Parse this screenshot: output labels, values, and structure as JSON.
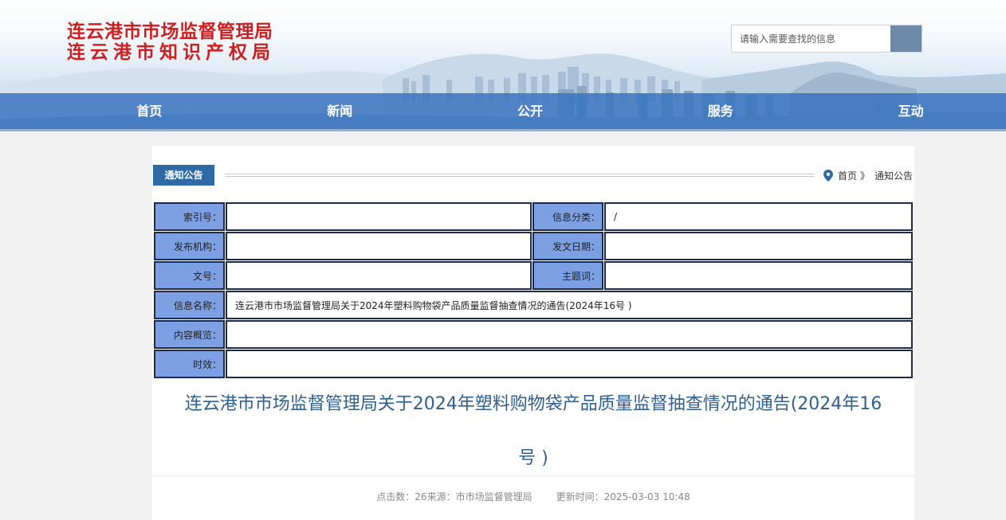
{
  "header": {
    "title_line1": "连云港市市场监督管理局",
    "title_line2": "连云港市知识产权局",
    "search_placeholder": "请输入需要查找的信息"
  },
  "nav": {
    "items": [
      "首页",
      "新闻",
      "公开",
      "服务",
      "互动"
    ]
  },
  "section": {
    "tag": "通知公告",
    "breadcrumb_home": "首页",
    "breadcrumb_sep": "》",
    "breadcrumb_current": "通知公告"
  },
  "meta": {
    "index_label": "索引号：",
    "index_value": "",
    "category_label": "信息分类：",
    "category_value": "/",
    "org_label": "发布机构：",
    "org_value": "",
    "date_label": "发文日期：",
    "date_value": "",
    "docno_label": "文号：",
    "docno_value": "",
    "subject_label": "主题词：",
    "subject_value": "",
    "name_label": "信息名称：",
    "name_value": "连云港市市场监督管理局关于2024年塑料购物袋产品质量监督抽查情况的通告(2024年16号 )",
    "summary_label": "内容概览：",
    "summary_value": "",
    "validity_label": "时效：",
    "validity_value": ""
  },
  "article": {
    "title_line1": "连云港市市场监督管理局关于2024年塑料购物袋产品质量监督抽查情况的通告(2024年16",
    "title_line2": "号 )",
    "clicks": "点击数：26",
    "source": "来源：市市场监督管理局",
    "updated": "更新时间：2025-03-03 10:48"
  },
  "colors": {
    "title_red": "#cc1f1f",
    "nav_blue": "#3470be",
    "label_cell": "#7d9fe3",
    "article_title": "#2f5f8f"
  }
}
